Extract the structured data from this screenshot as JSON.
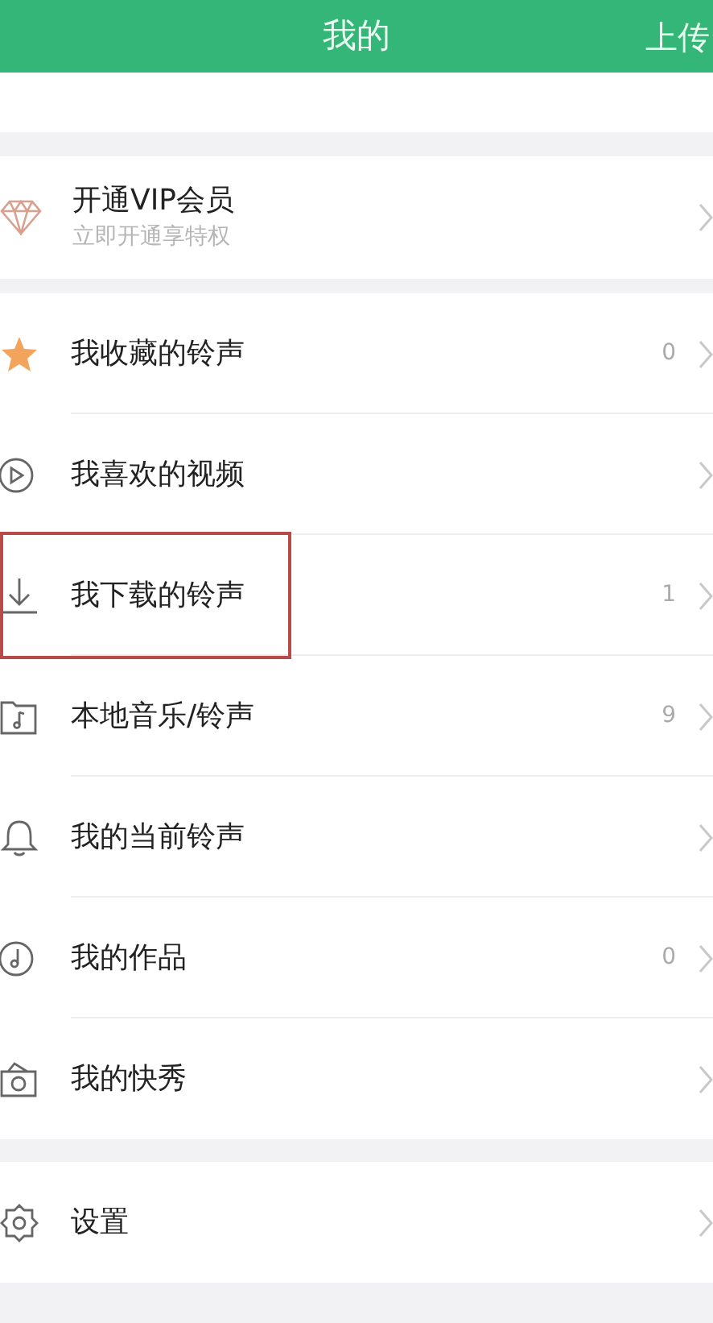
{
  "header": {
    "title": "我的",
    "action": "上传"
  },
  "vip": {
    "title": "开通VIP会员",
    "subtitle": "立即开通享特权"
  },
  "sections": [
    [
      {
        "kind": "star",
        "label": "我收藏的铃声",
        "count": "0",
        "highlighted": false
      },
      {
        "kind": "play",
        "label": "我喜欢的视频",
        "highlighted": false
      },
      {
        "kind": "download",
        "label": "我下载的铃声",
        "count": "1",
        "highlighted": true
      },
      {
        "kind": "folder",
        "label": "本地音乐/铃声",
        "count": "9",
        "highlighted": false
      },
      {
        "kind": "bell",
        "label": "我的当前铃声",
        "highlighted": false
      },
      {
        "kind": "note",
        "label": "我的作品",
        "count": "0",
        "highlighted": false
      },
      {
        "kind": "camera",
        "label": "我的快秀",
        "highlighted": false
      }
    ],
    [
      {
        "kind": "gear",
        "label": "设置",
        "highlighted": false
      }
    ]
  ]
}
